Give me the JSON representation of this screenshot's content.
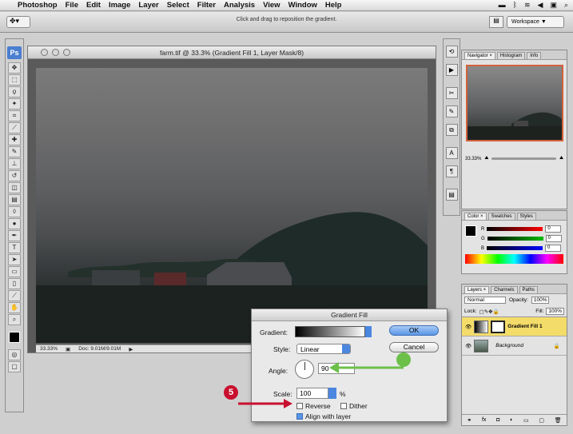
{
  "menubar": {
    "app": "Photoshop",
    "items": [
      "File",
      "Edit",
      "Image",
      "Layer",
      "Select",
      "Filter",
      "Analysis",
      "View",
      "Window",
      "Help"
    ]
  },
  "options_bar": {
    "hint": "Click and drag to reposition the gradient.",
    "workspace_label": "Workspace ▼"
  },
  "toolbox": {
    "logo": "Ps"
  },
  "document": {
    "title": "farm.tif @ 33.3% (Gradient Fill 1, Layer Mask/8)",
    "zoom": "33.33%",
    "doc_size": "Doc: 9.01M/9.01M"
  },
  "navigator": {
    "tabs": [
      "Navigator ×",
      "Histogram",
      "Info"
    ],
    "zoom": "33.33%"
  },
  "color_panel": {
    "tabs": [
      "Color ×",
      "Swatches",
      "Styles"
    ],
    "channels": [
      {
        "label": "R",
        "value": "0"
      },
      {
        "label": "G",
        "value": "0"
      },
      {
        "label": "B",
        "value": "0"
      }
    ]
  },
  "layers_panel": {
    "tabs": [
      "Layers ×",
      "Channels",
      "Paths"
    ],
    "blend_mode": "Normal",
    "opacity_label": "Opacity:",
    "opacity": "100%",
    "lock_label": "Lock:",
    "fill_label": "Fill:",
    "fill": "100%",
    "layers": [
      {
        "name": "Gradient Fill 1",
        "selected": true
      },
      {
        "name": "Background",
        "selected": false
      }
    ]
  },
  "dialog": {
    "title": "Gradient Fill",
    "gradient_label": "Gradient:",
    "style_label": "Style:",
    "style_value": "Linear",
    "angle_label": "Angle:",
    "angle_value": "90",
    "scale_label": "Scale:",
    "scale_value": "100",
    "scale_unit": "%",
    "ok": "OK",
    "cancel": "Cancel",
    "reverse": "Reverse",
    "reverse_checked": false,
    "dither": "Dither",
    "dither_checked": false,
    "align": "Align with layer",
    "align_checked": true
  },
  "callout": {
    "number": "5"
  },
  "colors": {
    "callout": "#c8102e",
    "arrow": "#c8102e",
    "angle_arrow": "#6cc04a",
    "accent": "#4b87e0"
  }
}
